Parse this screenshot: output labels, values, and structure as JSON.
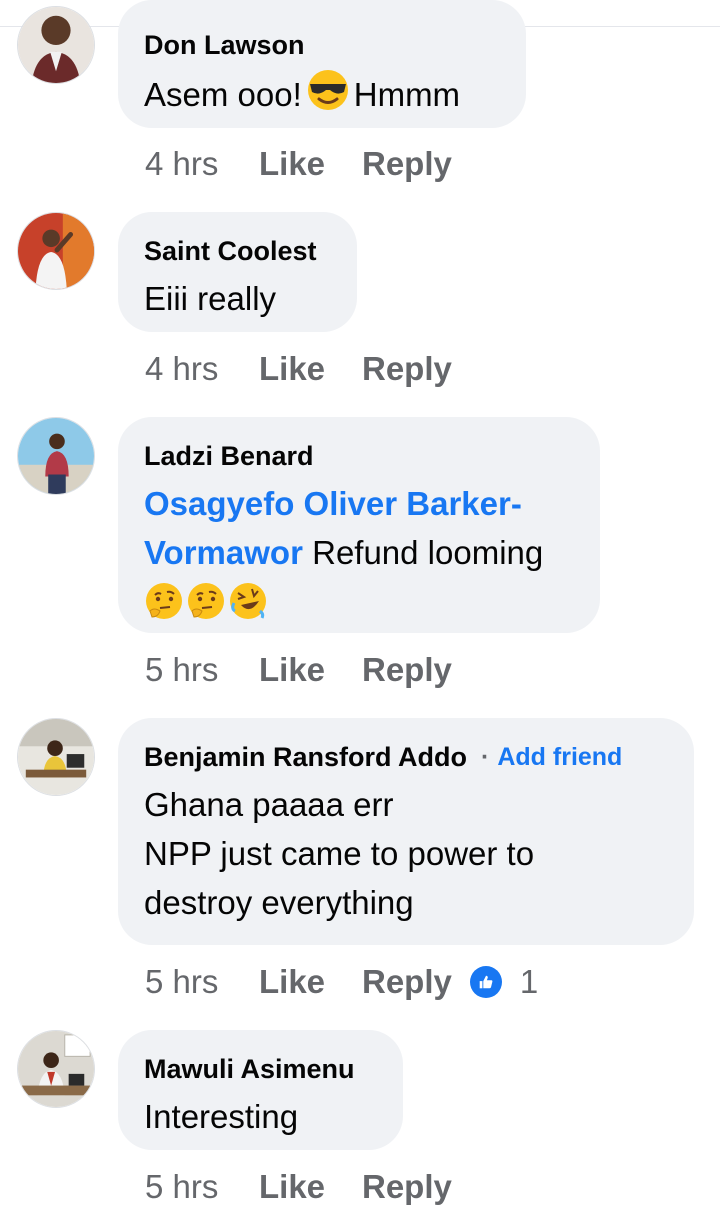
{
  "comments": [
    {
      "author": "Don Lawson",
      "text_before": "Asem ooo!",
      "emoji": "sunglasses-emoji",
      "text_after": "Hmmm",
      "time": "4 hrs",
      "like_label": "Like",
      "reply_label": "Reply"
    },
    {
      "author": "Saint Coolest",
      "text": "Eiii really",
      "time": "4 hrs",
      "like_label": "Like",
      "reply_label": "Reply"
    },
    {
      "author": "Ladzi Benard",
      "mention_line1": "Osagyefo Oliver Barker-",
      "mention_line2": "Vormawor",
      "text": " Refund looming",
      "emojis": [
        "thinking-emoji",
        "thinking-emoji",
        "rolling-laughing-emoji"
      ],
      "time": "5 hrs",
      "like_label": "Like",
      "reply_label": "Reply"
    },
    {
      "author": "Benjamin Ransford Addo",
      "add_friend_label": "Add friend",
      "lines": [
        "Ghana paaaa err",
        "NPP just came to power to",
        "destroy everything"
      ],
      "time": "5 hrs",
      "like_label": "Like",
      "reply_label": "Reply",
      "reaction_icon": "thumbs-up-icon",
      "reaction_count": "1"
    },
    {
      "author": "Mawuli Asimenu",
      "text": "Interesting",
      "time": "5 hrs",
      "like_label": "Like",
      "reply_label": "Reply"
    }
  ],
  "colors": {
    "bubble": "#f0f2f5",
    "link": "#1877f2",
    "meta": "#65676b"
  }
}
